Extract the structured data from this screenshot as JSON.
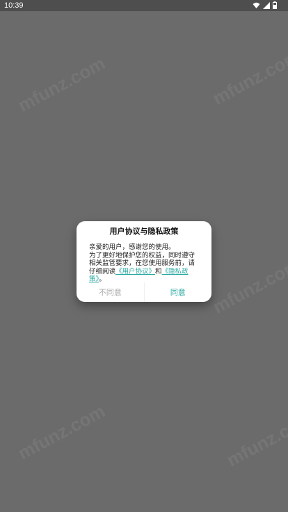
{
  "status_bar": {
    "time": "10:39",
    "icons": [
      "wifi-icon",
      "signal-icon",
      "battery-icon"
    ]
  },
  "watermark": {
    "text": "mfunz.com"
  },
  "dialog": {
    "title": "用户协议与隐私政策",
    "line1": "亲爱的用户，感谢您的使用。",
    "line2_prefix": "为了更好地保护您的权益，同时遵守相关监管要求，在您使用服务前，请仔细阅读",
    "user_agreement_link": "《用户协议》",
    "and": "和",
    "privacy_policy_link": "《隐私政策》",
    "period": "。",
    "disagree_label": "不同意",
    "agree_label": "同意",
    "accent_color": "#27a8a0"
  }
}
